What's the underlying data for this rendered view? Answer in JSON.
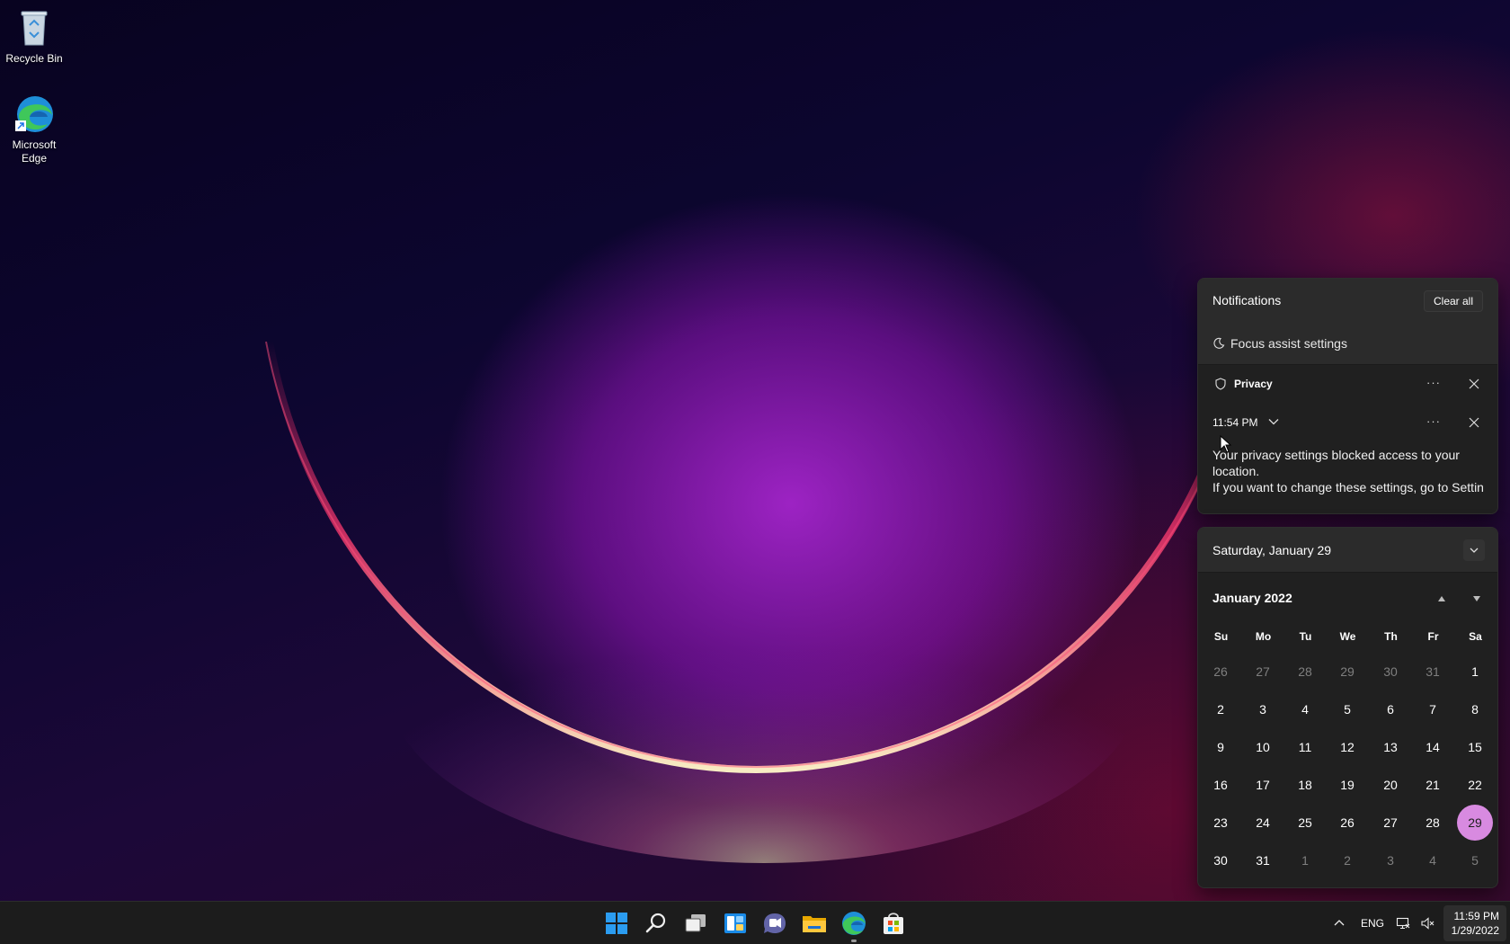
{
  "desktop": {
    "icons": [
      {
        "label": "Recycle Bin",
        "icon": "recycle-bin-icon"
      },
      {
        "label": "Microsoft Edge",
        "icon": "edge-icon"
      }
    ]
  },
  "notifications": {
    "title": "Notifications",
    "clear_all_label": "Clear all",
    "focus_assist_label": "Focus assist settings",
    "group": {
      "app_name": "Privacy",
      "app_icon": "shield-icon",
      "more_label": "···"
    },
    "item": {
      "time": "11:54 PM",
      "more_label": "···",
      "body_line1": "Your privacy settings blocked access to your location.",
      "body_line2": "If you want to change these settings, go to Settin"
    }
  },
  "calendar": {
    "date_title": "Saturday, January 29",
    "month_title": "January 2022",
    "day_names": [
      "Su",
      "Mo",
      "Tu",
      "We",
      "Th",
      "Fr",
      "Sa"
    ],
    "weeks": [
      [
        "26",
        "27",
        "28",
        "29",
        "30",
        "31",
        "1"
      ],
      [
        "2",
        "3",
        "4",
        "5",
        "6",
        "7",
        "8"
      ],
      [
        "9",
        "10",
        "11",
        "12",
        "13",
        "14",
        "15"
      ],
      [
        "16",
        "17",
        "18",
        "19",
        "20",
        "21",
        "22"
      ],
      [
        "23",
        "24",
        "25",
        "26",
        "27",
        "28",
        "29"
      ],
      [
        "30",
        "31",
        "1",
        "2",
        "3",
        "4",
        "5"
      ]
    ],
    "today": "29",
    "today_color": "#d88ae0"
  },
  "taskbar": {
    "apps": [
      "start-icon",
      "search-icon",
      "task-view-icon",
      "widgets-icon",
      "teams-chat-icon",
      "file-explorer-icon",
      "edge-icon",
      "store-icon"
    ],
    "tray": {
      "language": "ENG",
      "time": "11:59 PM",
      "date": "1/29/2022"
    }
  }
}
